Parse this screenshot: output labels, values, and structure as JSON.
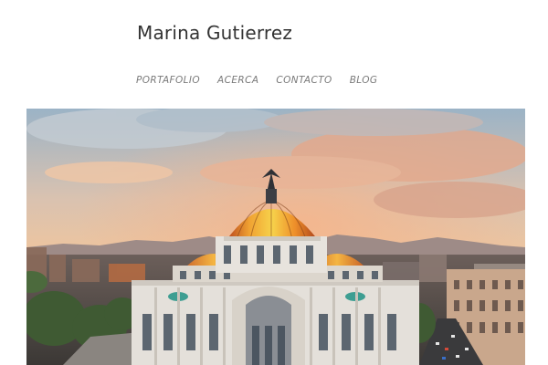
{
  "site": {
    "title": "Marina Gutierrez"
  },
  "nav": {
    "items": [
      {
        "label": "PORTAFOLIO"
      },
      {
        "label": "ACERCA"
      },
      {
        "label": "CONTACTO"
      },
      {
        "label": "BLOG"
      }
    ]
  },
  "hero": {
    "subject": "palacio-de-bellas-artes-photo"
  },
  "colors": {
    "title": "#333333",
    "nav": "#7a7a7a",
    "sky_top": "#9fb6c8",
    "sky_glow": "#f2b98a",
    "dome_orange": "#e8872a",
    "marble": "#e4e0da"
  }
}
